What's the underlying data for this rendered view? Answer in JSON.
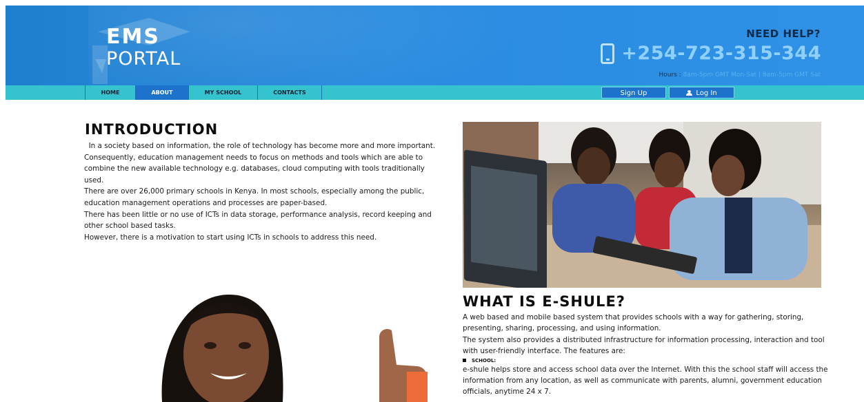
{
  "brand": {
    "line1": "EMS",
    "line2": "PORTAL"
  },
  "help": {
    "heading": "NEED HELP?",
    "phone": "+254-723-315-344",
    "hours_label": "Hours :",
    "hours_value": "8am-5pm GMT Mon-Sat | 8am-5pm GMT Sat"
  },
  "nav": {
    "items": [
      {
        "label": "HOME",
        "active": false
      },
      {
        "label": "ABOUT",
        "active": true
      },
      {
        "label": "MY SCHOOL",
        "active": false
      },
      {
        "label": "CONTACTS",
        "active": false
      }
    ],
    "signup_label": "Sign Up",
    "login_label": "Log In"
  },
  "intro": {
    "title": "INTRODUCTION",
    "paragraphs": [
      "  In a society based on information, the role of technology has become more and more important.",
      "Consequently, education management needs to focus on methods and tools which are able to combine the new available technology e.g. databases, cloud computing with tools traditionally used.",
      "There are over 26,000 primary schools in Kenya. In most schools, especially among the public, education management operations and processes are paper-based.",
      "There has been little or no use of ICTs in data storage, performance analysis, record keeping and other school based tasks.",
      "However, there is a motivation to start using ICTs in schools to address this need."
    ]
  },
  "what": {
    "title": "WHAT IS E-SHULE?",
    "paragraphs": [
      "A web based and mobile based system that provides schools with a way for gathering, storing, presenting, sharing, processing, and using information.",
      "The system also provides a distributed infrastructure for information processing, interaction and tool with user-friendly interface. The features are:"
    ],
    "feature_school_label": "SCHOOL:",
    "feature_school_text": "e-shule helps store and access school data over the Internet. With this the school staff will access the information from any location, as well as communicate with parents, alumni, government education officials, anytime 24 x 7."
  },
  "colors": {
    "header": "#2a8be0",
    "navbar": "#35c3cf",
    "active": "#1d72cb"
  }
}
